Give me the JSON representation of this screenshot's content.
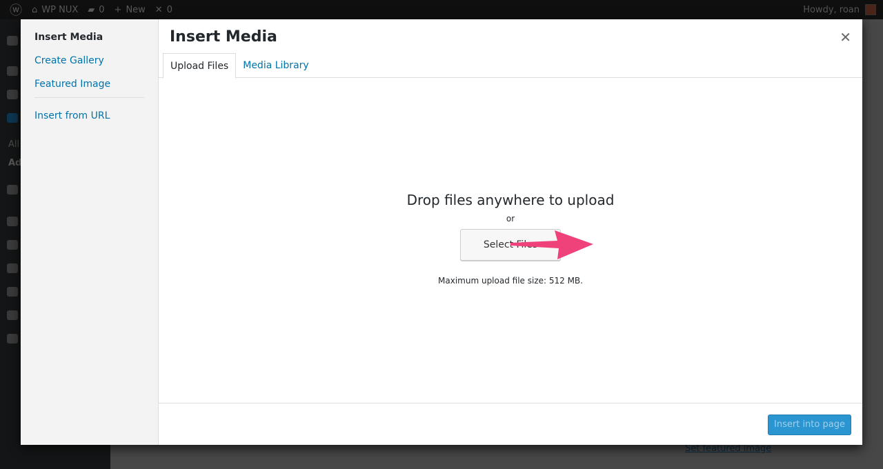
{
  "adminbar": {
    "site": "WP NUX",
    "comments": "0",
    "new": "New",
    "updates": "0",
    "howdy": "Howdy, roan"
  },
  "background": {
    "sidebar_all": "All",
    "sidebar_add": "Ad",
    "featured_link": "Set featured image"
  },
  "modal": {
    "menu": [
      {
        "label": "Insert Media",
        "active": true
      },
      {
        "label": "Create Gallery"
      },
      {
        "label": "Featured Image"
      },
      {
        "label": "Insert from URL"
      }
    ],
    "title": "Insert Media",
    "close_icon": "close-icon",
    "tabs": [
      {
        "label": "Upload Files",
        "active": true
      },
      {
        "label": "Media Library"
      }
    ],
    "upload": {
      "heading": "Drop files anywhere to upload",
      "or": "or",
      "button": "Select Files",
      "max_size": "Maximum upload file size: 512 MB."
    },
    "insert_button": "Insert into page"
  },
  "colors": {
    "accent": "#0073aa",
    "primary_button": "#2a95d0",
    "arrow": "#f0427a"
  }
}
